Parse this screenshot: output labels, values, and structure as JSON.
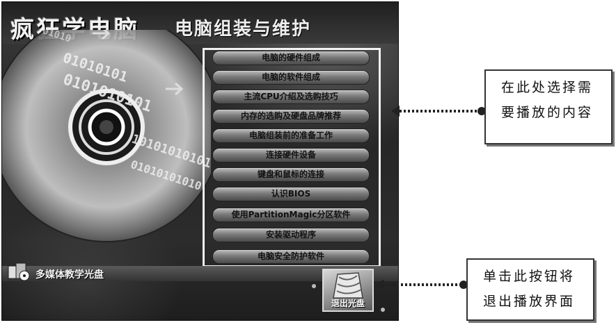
{
  "app": {
    "title": "疯狂学电脑",
    "section_title": "电脑组装与维护",
    "footer_label": "多媒体教学光盘",
    "exit_label": "退出光盘"
  },
  "menu": {
    "items": [
      "电脑的硬件组成",
      "电脑的软件组成",
      "主流CPU介绍及选购技巧",
      "内存的选购及硬盘品牌推荐",
      "电脑组装前的准备工作",
      "连接硬件设备",
      "键盘和鼠标的连接",
      "认识BIOS",
      "使用PartitionMagic分区软件",
      "安装驱动程序",
      "电脑安全防护软件"
    ]
  },
  "callouts": {
    "menu_hint": [
      "在此处选择需",
      "要播放的内容"
    ],
    "exit_hint": [
      "单击此按钮将",
      "退出播放界面"
    ]
  },
  "decor": {
    "binary_rows": [
      "01010101",
      "0101010101",
      "1010101010101",
      "01010101010",
      "01010"
    ]
  },
  "colors": {
    "window_bg": "#2a2a2a",
    "menu_frame": "#f2f2f2",
    "menu_item": "#8a8a8a",
    "callout_border": "#333333",
    "arrow": "#222222"
  }
}
